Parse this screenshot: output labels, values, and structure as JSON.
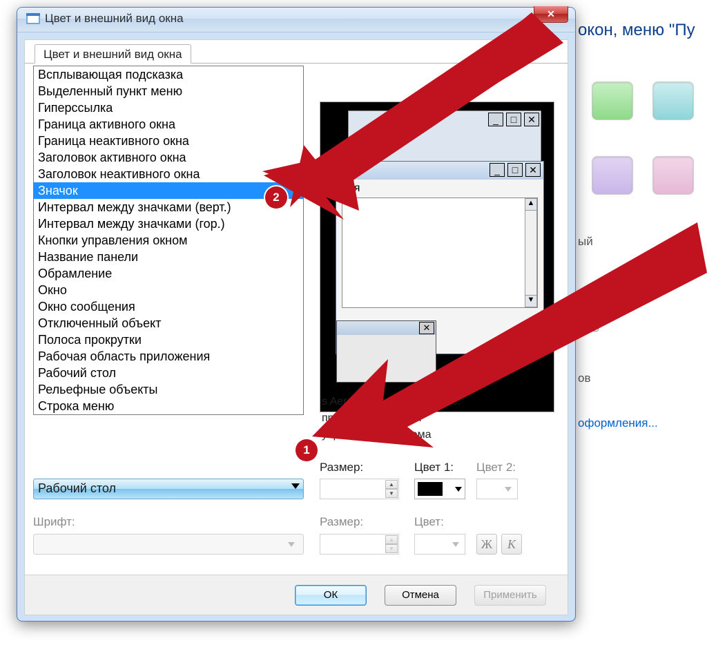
{
  "bg": {
    "headline_fragment": "окон, меню \"Пу",
    "side_text_1": "ый",
    "side_text_2": "ов",
    "side_link": "оформления..."
  },
  "window": {
    "title": "Цвет и внешний вид окна",
    "tab": "Цвет и внешний вид окна"
  },
  "dropdown": {
    "items": [
      "Всплывающая подсказка",
      "Выделенный пункт меню",
      "Гиперссылка",
      "Граница активного окна",
      "Граница неактивного окна",
      "Заголовок активного окна",
      "Заголовок неактивного окна",
      "Значок",
      "Интервал между значками (верт.)",
      "Интервал между значками (гор.)",
      "Кнопки управления окном",
      "Название панели",
      "Обрамление",
      "Окно",
      "Окно сообщения",
      "Отключенный объект",
      "Полоса прокрутки",
      "Рабочая область приложения",
      "Рабочий стол",
      "Рельефные объекты",
      "Строка меню"
    ],
    "selected": "Значок",
    "combo_display": "Рабочий стол"
  },
  "labels": {
    "font": "Шрифт:",
    "size": "Размер:",
    "color1": "Цвет 1:",
    "color2": "Цвет 2:",
    "size2": "Размер:",
    "color": "Цвет:",
    "bold": "Ж",
    "italic": "К"
  },
  "preview": {
    "active_title_fragment": "ная",
    "caption_l1": "s Aero\" выберите            Windows.",
    "caption_l2": "применять          ко в том",
    "caption_l3": "упро               стиль\" или тема"
  },
  "buttons": {
    "ok": "ОК",
    "cancel": "Отмена",
    "apply": "Применить"
  },
  "anno": {
    "badge1": "1",
    "badge2": "2"
  }
}
